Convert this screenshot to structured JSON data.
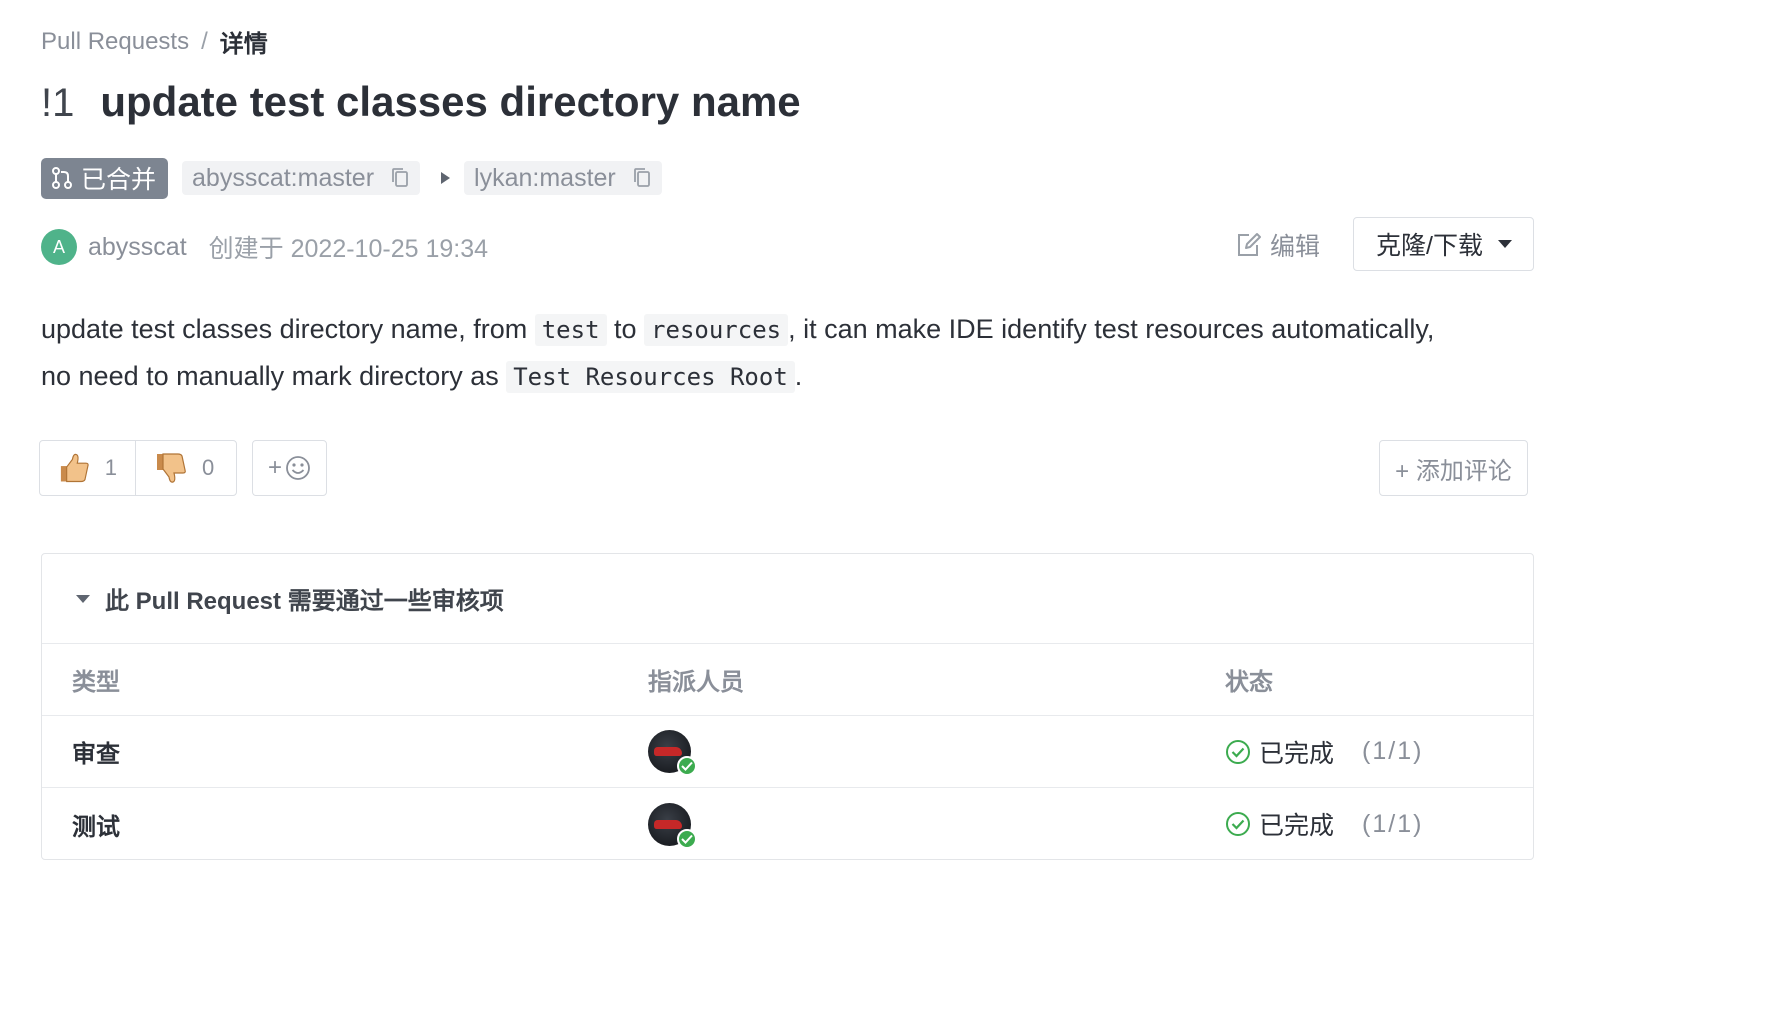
{
  "breadcrumb": {
    "parent": "Pull Requests",
    "separator": "/",
    "current": "详情"
  },
  "pr": {
    "number": "!1",
    "title": "update test classes directory name",
    "status_badge": "已合并",
    "source_branch": "abysscat:master",
    "target_branch": "lykan:master"
  },
  "meta": {
    "avatar_letter": "A",
    "author": "abysscat",
    "created": "创建于 2022-10-25 19:34"
  },
  "actions": {
    "edit_label": "编辑",
    "clone_label": "克隆/下载"
  },
  "description": {
    "line1_a": "update test classes directory name, from ",
    "code1": "test",
    "line1_b": " to ",
    "code2": "resources",
    "line1_c": ", it can make IDE identify test resources automatically,",
    "line2_a": "no need to manually mark directory as ",
    "code3": "Test Resources Root",
    "line2_b": "."
  },
  "reactions": {
    "thumbs_up_count": "1",
    "thumbs_down_count": "0",
    "add_emoji_plus": "+"
  },
  "add_comment_label": "+ 添加评论",
  "review": {
    "header": "此 Pull Request 需要通过一些审核项",
    "columns": {
      "type": "类型",
      "assignee": "指派人员",
      "status": "状态"
    },
    "rows": [
      {
        "type": "审查",
        "status": "已完成",
        "count": "(1/1)"
      },
      {
        "type": "测试",
        "status": "已完成",
        "count": "(1/1)"
      }
    ]
  },
  "colors": {
    "merged_badge": "#7d8591",
    "avatar": "#4fb38a",
    "success": "#3cab4f"
  }
}
